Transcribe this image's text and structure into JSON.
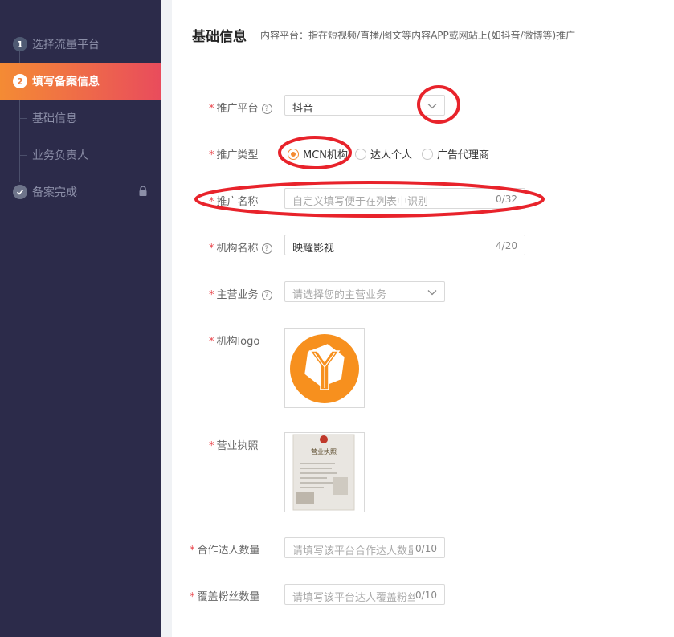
{
  "sidebar": {
    "steps": [
      {
        "num": "1",
        "label": "选择流量平台"
      },
      {
        "num": "2",
        "label": "填写备案信息"
      },
      {
        "label": "基础信息"
      },
      {
        "label": "业务负责人"
      },
      {
        "label": "备案完成"
      }
    ]
  },
  "header": {
    "title": "基础信息",
    "subtitle": "内容平台：指在短视频/直播/图文等内容APP或网站上(如抖音/微博等)推广"
  },
  "form": {
    "required_mark": "*",
    "help_glyph": "?",
    "platform": {
      "label": "推广平台",
      "value": "抖音"
    },
    "type": {
      "label": "推广类型",
      "options": [
        "MCN机构",
        "达人个人",
        "广告代理商"
      ],
      "selected": "MCN机构"
    },
    "promo_name": {
      "label": "推广名称",
      "placeholder": "自定义填写便于在列表中识别",
      "count": "0/32"
    },
    "org_name": {
      "label": "机构名称",
      "value": "映耀影视",
      "count": "4/20"
    },
    "business": {
      "label": "主营业务",
      "placeholder": "请选择您的主营业务"
    },
    "logo": {
      "label": "机构logo"
    },
    "license": {
      "label": "营业执照",
      "stamp_text": "营业执照"
    },
    "talent_count": {
      "label": "合作达人数量",
      "placeholder": "请填写该平台合作达人数量",
      "count": "0/10"
    },
    "fans_count": {
      "label": "覆盖粉丝数量",
      "placeholder": "请填写该平台达人覆盖粉丝数量",
      "count": "0/10"
    }
  },
  "colors": {
    "accent": "#f48b34",
    "sidebar_bg": "#2c2b4a",
    "annotation": "#e8232b"
  }
}
